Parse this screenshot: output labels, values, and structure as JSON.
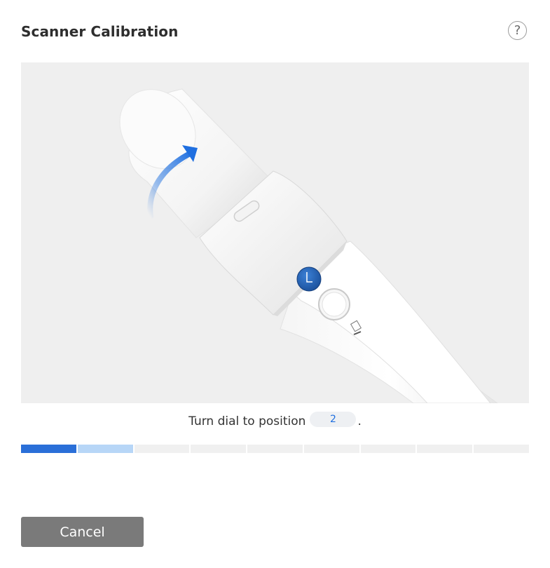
{
  "dialog": {
    "title": "Scanner Calibration",
    "help_label": "?"
  },
  "illustration": {
    "description_icon": "scanner-dial-illustration",
    "arrow_icon": "rotate-arrow-icon",
    "device_label": "①"
  },
  "instruction": {
    "prefix": "Turn dial to position",
    "position_value": "2",
    "suffix": "."
  },
  "progress": {
    "total_steps": 9,
    "current_step": 1,
    "next_step": 2,
    "colors": {
      "active": "#2a6fd8",
      "next": "#b7d6f7",
      "inactive": "#f0f0f0"
    }
  },
  "buttons": {
    "cancel_label": "Cancel"
  }
}
